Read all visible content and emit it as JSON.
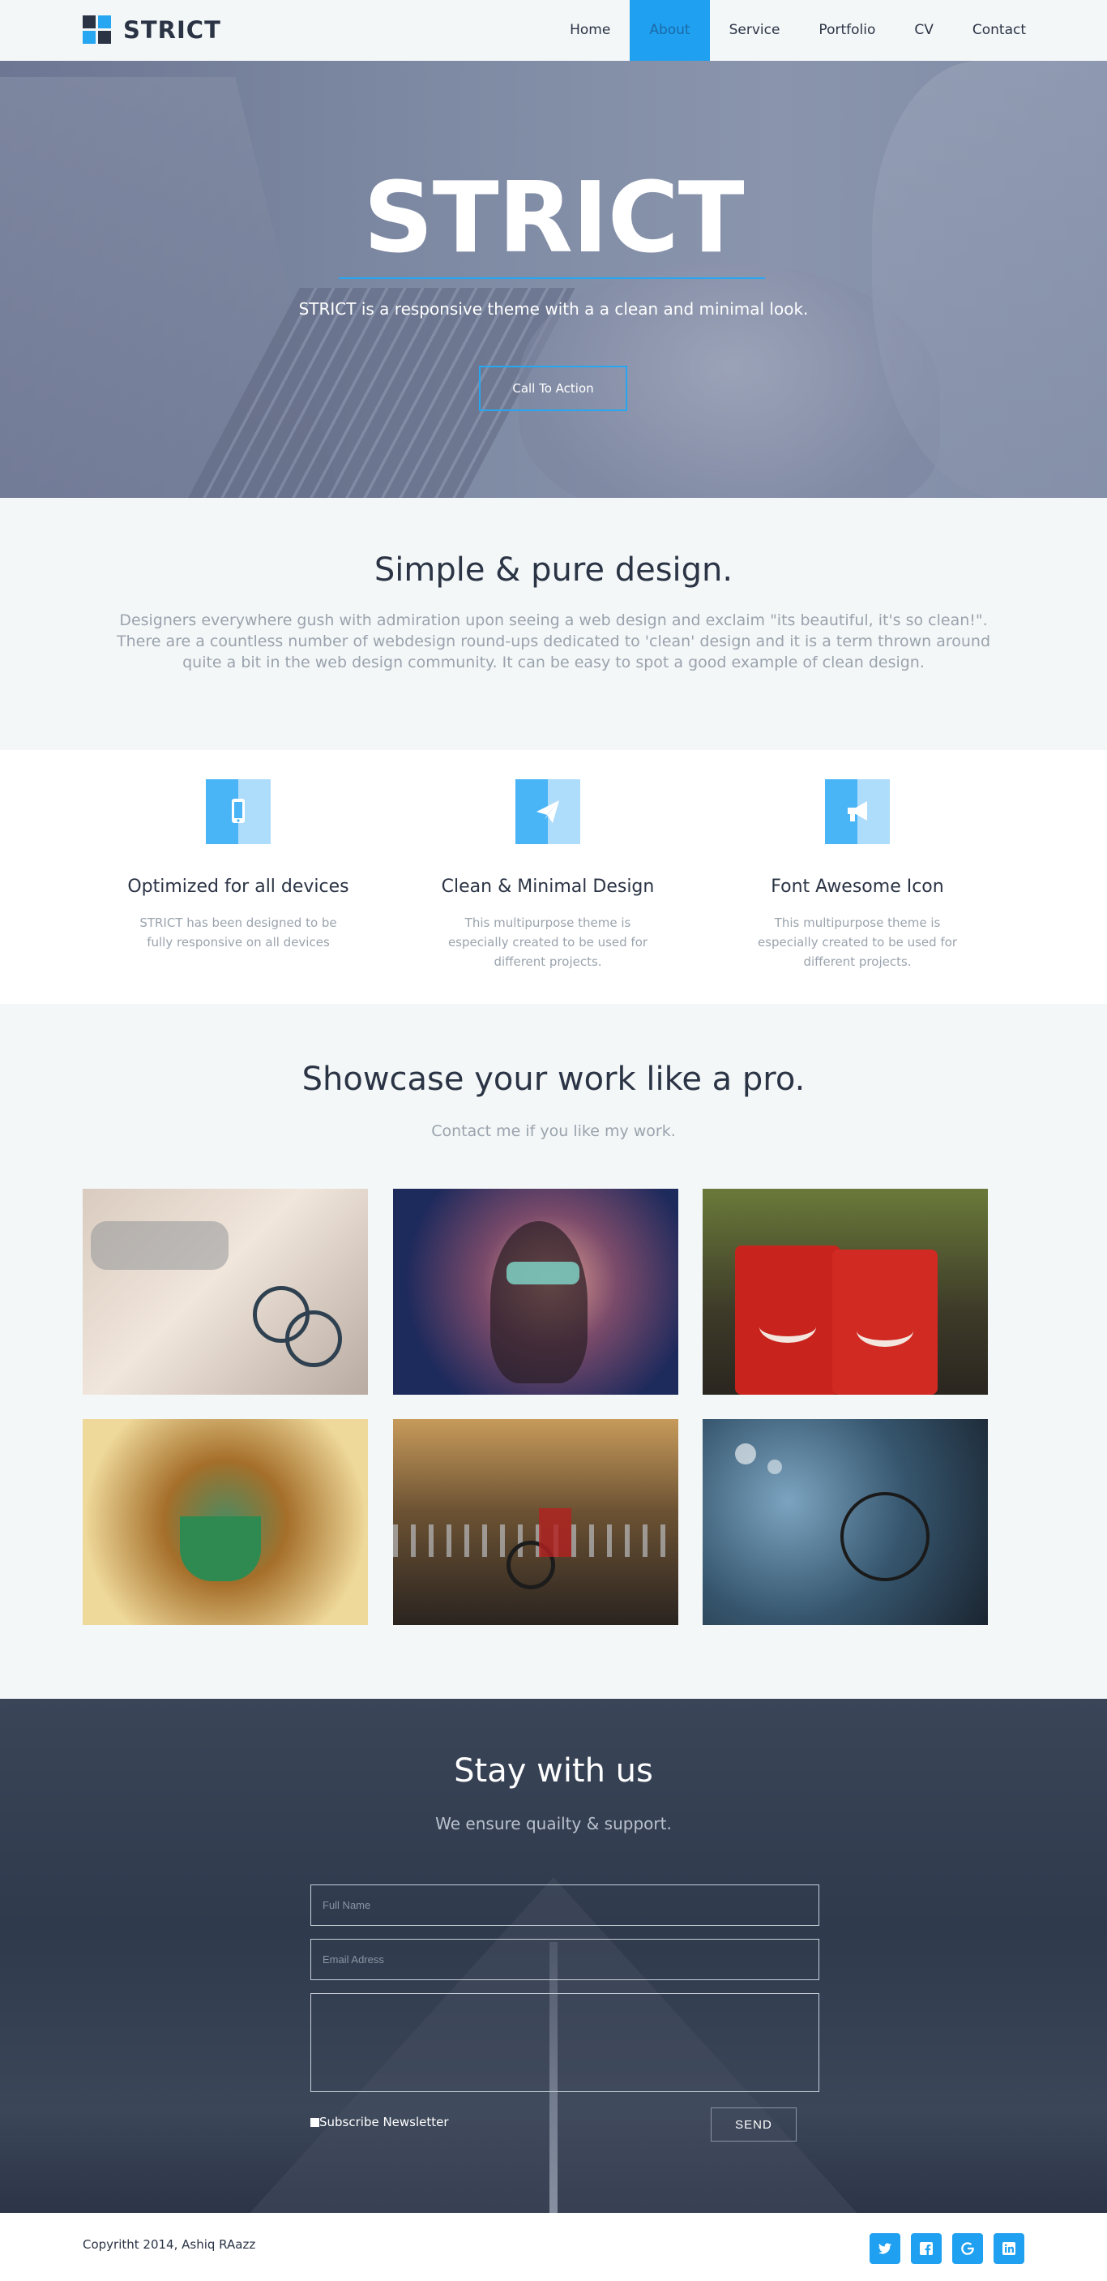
{
  "brand": {
    "name": "STRICT"
  },
  "nav": {
    "items": [
      {
        "label": "Home"
      },
      {
        "label": "About"
      },
      {
        "label": "Service"
      },
      {
        "label": "Portfolio"
      },
      {
        "label": "CV"
      },
      {
        "label": "Contact"
      }
    ],
    "active": "About"
  },
  "hero": {
    "title": "STRICT",
    "subtitle": "STRICT is a responsive theme with a a clean and minimal look.",
    "cta_label": "Call To Action"
  },
  "intro": {
    "title": "Simple & pure design.",
    "text": "Designers everywhere gush with admiration upon seeing a web design and exclaim \"its beautiful, it's so clean!\". There are a countless number of webdesign round-ups dedicated to 'clean' design and it is a term thrown around quite a bit in the web design community. It can be easy to spot a good example of clean design."
  },
  "features": [
    {
      "icon": "mobile-icon",
      "title": "Optimized for all devices",
      "text": "STRICT has been designed to be fully responsive on all devices"
    },
    {
      "icon": "paper-plane-icon",
      "title": "Clean & Minimal Design",
      "text": "This multipurpose theme is especially created to be used for different projects."
    },
    {
      "icon": "bullhorn-icon",
      "title": "Font Awesome Icon",
      "text": "This multipurpose theme is especially created to be used for different projects."
    }
  ],
  "portfolio": {
    "title": "Showcase your work like a pro.",
    "subtitle": "Contact me if you like my work.",
    "items": [
      {
        "name": "street-bicycle-photo"
      },
      {
        "name": "woman-sunglasses-photo"
      },
      {
        "name": "red-smiley-mugs-photo"
      },
      {
        "name": "coffee-splash-photo"
      },
      {
        "name": "red-bicycle-photo"
      },
      {
        "name": "night-bicycle-photo"
      }
    ]
  },
  "contact": {
    "title": "Stay with us",
    "subtitle": "We ensure quailty & support.",
    "name_placeholder": "Full Name",
    "email_placeholder": "Email Adress",
    "message_placeholder": "",
    "subscribe_label": "Subscribe Newsletter",
    "send_label": "SEND"
  },
  "footer": {
    "copyright": "Copyritht 2014, Ashiq RAazz",
    "social": [
      "twitter-icon",
      "facebook-icon",
      "google-icon",
      "linkedin-icon"
    ]
  },
  "colors": {
    "accent": "#1fa0f0",
    "dark": "#2b3445",
    "muted": "#9aa3ad",
    "background": "#f4f7f8"
  }
}
